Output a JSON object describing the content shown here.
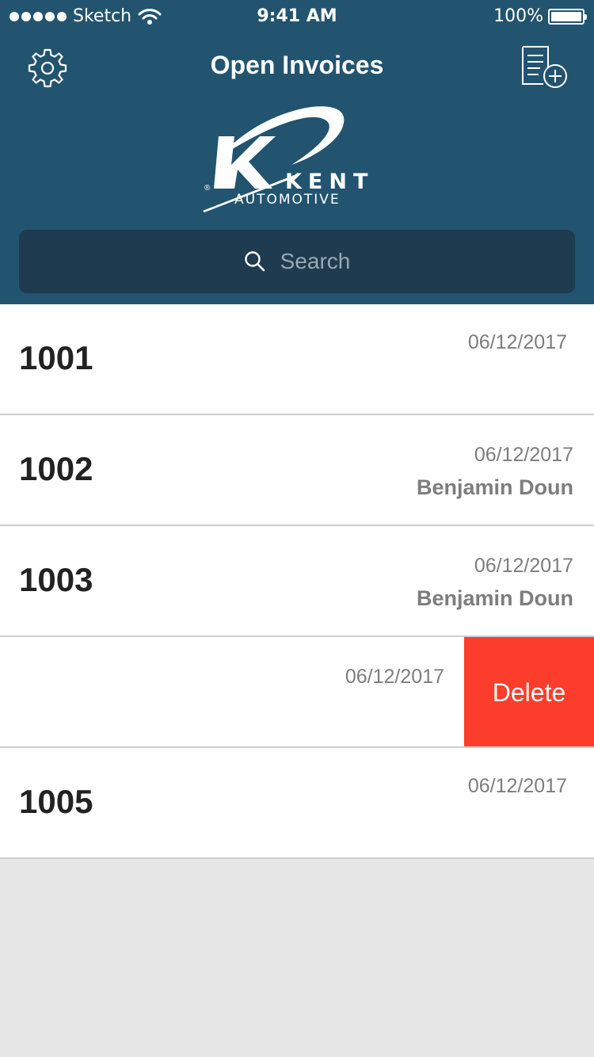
{
  "status_bar": {
    "carrier": "Sketch",
    "time": "9:41 AM",
    "battery": "100%"
  },
  "header": {
    "title": "Open Invoices",
    "settings_icon": "gear-icon",
    "new_invoice_icon": "document-add-icon"
  },
  "logo": {
    "brand": "KENT",
    "sub": "AUTOMOTIVE",
    "registered": "®"
  },
  "search": {
    "placeholder": "Search",
    "icon": "search-icon"
  },
  "invoices": [
    {
      "number": "1001",
      "date": "06/12/2017",
      "customer": ""
    },
    {
      "number": "1002",
      "date": "06/12/2017",
      "customer": "Benjamin Doun"
    },
    {
      "number": "1003",
      "date": "06/12/2017",
      "customer": "Benjamin Doun"
    },
    {
      "number": "",
      "date": "06/12/2017",
      "customer": "",
      "swiped": true
    },
    {
      "number": "1005",
      "date": "06/12/2017",
      "customer": ""
    }
  ],
  "actions": {
    "delete_label": "Delete"
  },
  "colors": {
    "header_bg": "#225470",
    "search_bg": "#1e3b4f",
    "delete_bg": "#fc3d2b",
    "list_bg": "#ffffff",
    "empty_bg": "#e6e6e6"
  }
}
